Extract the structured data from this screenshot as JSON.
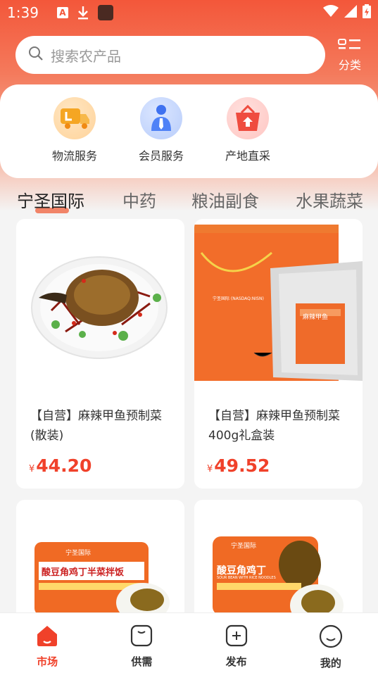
{
  "status_bar": {
    "time": "1:39",
    "icons": [
      "a-notification-icon",
      "download-icon",
      "app-square-icon",
      "wifi-icon",
      "signal-icon",
      "battery-icon"
    ]
  },
  "search": {
    "placeholder": "搜索农产品"
  },
  "category": {
    "label": "分类"
  },
  "services": [
    {
      "label": "物流服务",
      "icon": "truck-icon"
    },
    {
      "label": "会员服务",
      "icon": "member-icon"
    },
    {
      "label": "产地直采",
      "icon": "basket-icon"
    }
  ],
  "tabs": [
    {
      "label": "宁圣国际",
      "active": true
    },
    {
      "label": "中药",
      "active": false
    },
    {
      "label": "粮油副食",
      "active": false
    },
    {
      "label": "水果蔬菜",
      "active": false
    }
  ],
  "products": [
    {
      "title": "【自营】麻辣甲鱼预制菜(散装)",
      "currency": "¥",
      "price": "44.20"
    },
    {
      "title": "【自营】麻辣甲鱼预制菜400g礼盒装",
      "currency": "¥",
      "price": "49.52"
    },
    {
      "title": "",
      "currency": "",
      "price": ""
    },
    {
      "title": "",
      "currency": "",
      "price": ""
    }
  ],
  "product_image_text": {
    "box_brand": "宁圣国际 (NASDAQ:NISN)",
    "bag_label": "麻辣甲鱼",
    "meal1_brand": "宁圣国际",
    "meal1_name": "酸豆角鸡丁半菜拌饭",
    "meal2_brand": "宁圣国际",
    "meal2_name": "酸豆角鸡丁",
    "meal2_sub": "SOUR BEAN WITH RICE NOODLES"
  },
  "bottom_nav": [
    {
      "label": "市场",
      "icon": "home-icon",
      "active": true
    },
    {
      "label": "供需",
      "icon": "supply-icon",
      "active": false
    },
    {
      "label": "发布",
      "icon": "publish-icon",
      "active": false
    },
    {
      "label": "我的",
      "icon": "profile-icon",
      "active": false
    }
  ],
  "colors": {
    "accent": "#f0412a",
    "header_gradient_top": "#f3573a"
  }
}
